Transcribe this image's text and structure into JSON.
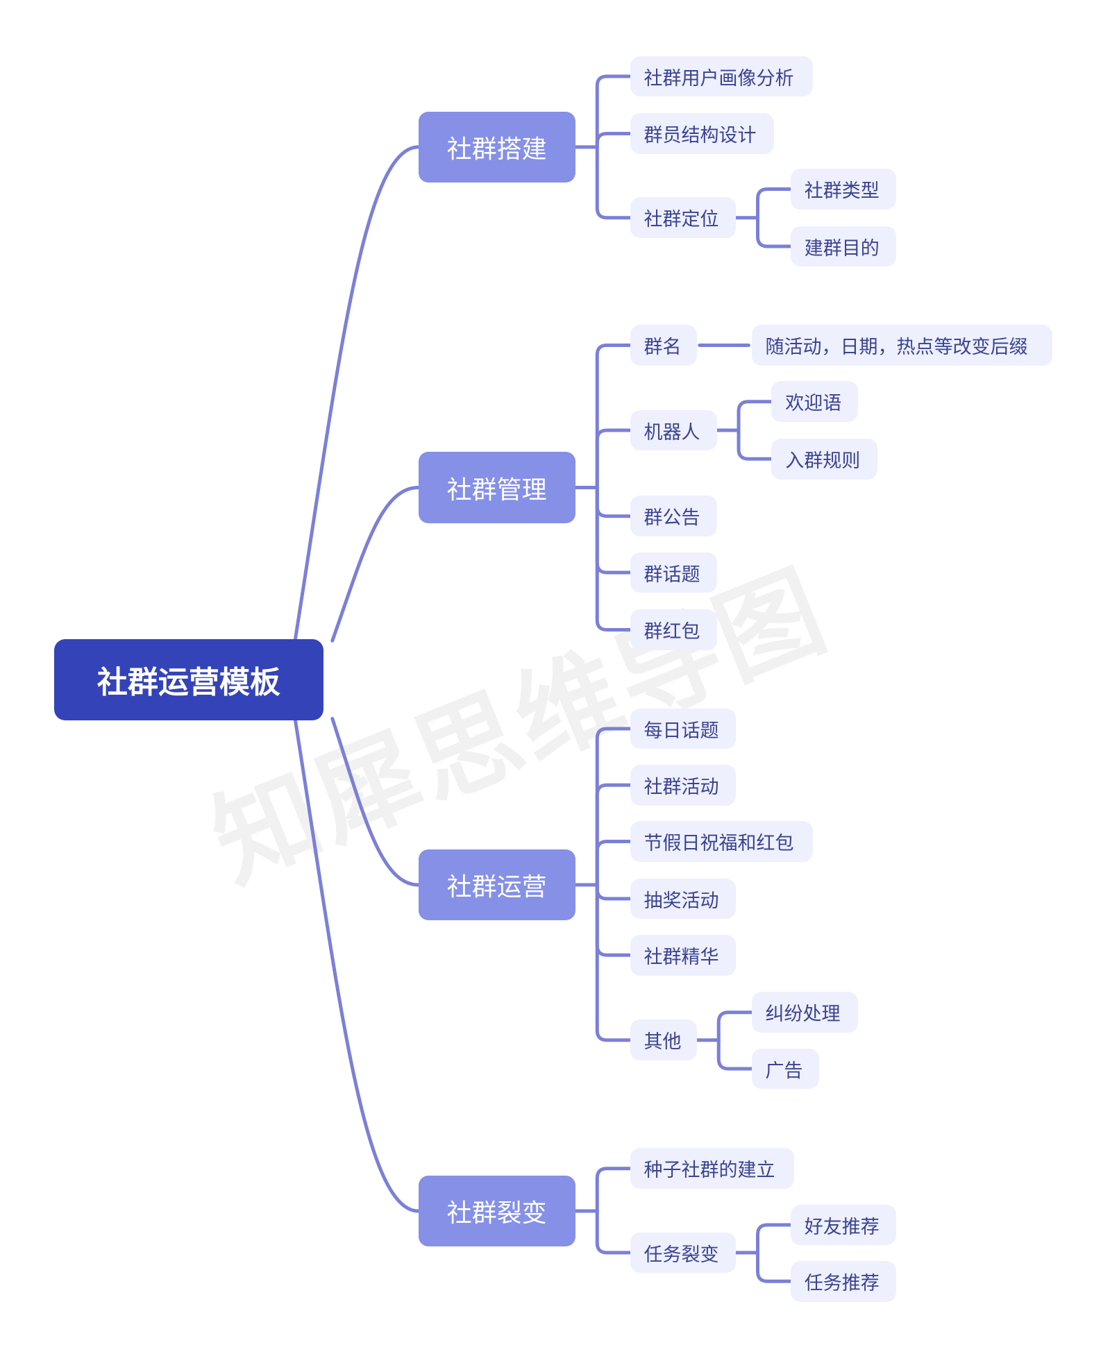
{
  "title": "社群运营模板",
  "watermark": "知犀思维导图",
  "colors": {
    "root_fill": "#3443b8",
    "branch_fill": "#8590e6",
    "leaf_fill": "#eef0fd",
    "leaf_text": "#3b4390",
    "connector": "#7b80d6"
  },
  "root": {
    "label": "社群运营模板",
    "children": [
      {
        "label": "社群搭建",
        "children": [
          {
            "label": "社群用户画像分析",
            "children": []
          },
          {
            "label": "群员结构设计",
            "children": []
          },
          {
            "label": "社群定位",
            "children": [
              {
                "label": "社群类型"
              },
              {
                "label": "建群目的"
              }
            ]
          }
        ]
      },
      {
        "label": "社群管理",
        "children": [
          {
            "label": "群名",
            "children": [
              {
                "label": "随活动，日期，热点等改变后缀"
              }
            ]
          },
          {
            "label": "机器人",
            "children": [
              {
                "label": "欢迎语"
              },
              {
                "label": "入群规则"
              }
            ]
          },
          {
            "label": "群公告",
            "children": []
          },
          {
            "label": "群话题",
            "children": []
          },
          {
            "label": "群红包",
            "children": []
          }
        ]
      },
      {
        "label": "社群运营",
        "children": [
          {
            "label": "每日话题",
            "children": []
          },
          {
            "label": "社群活动",
            "children": []
          },
          {
            "label": "节假日祝福和红包",
            "children": []
          },
          {
            "label": "抽奖活动",
            "children": []
          },
          {
            "label": "社群精华",
            "children": []
          },
          {
            "label": "其他",
            "children": [
              {
                "label": "纠纷处理"
              },
              {
                "label": "广告"
              }
            ]
          }
        ]
      },
      {
        "label": "社群裂变",
        "children": [
          {
            "label": "种子社群的建立",
            "children": []
          },
          {
            "label": "任务裂变",
            "children": [
              {
                "label": "好友推荐"
              },
              {
                "label": "任务推荐"
              }
            ]
          }
        ]
      }
    ]
  }
}
